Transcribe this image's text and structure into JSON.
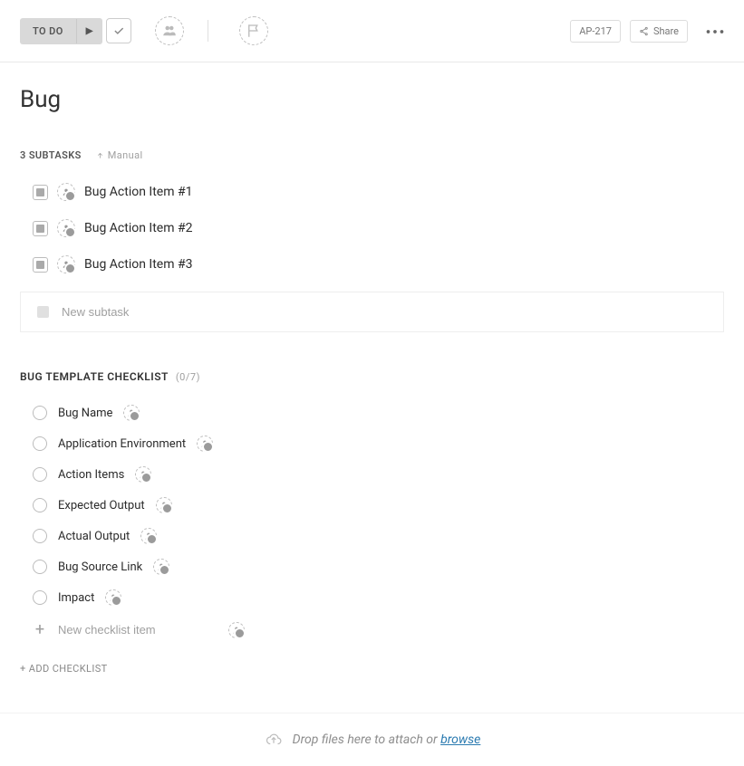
{
  "toolbar": {
    "status_label": "TO DO",
    "ticket_id": "AP-217",
    "share_label": "Share"
  },
  "title": "Bug",
  "subtasks": {
    "header": "3 SUBTASKS",
    "sort_label": "Manual",
    "items": [
      {
        "title": "Bug Action Item #1"
      },
      {
        "title": "Bug Action Item #2"
      },
      {
        "title": "Bug Action Item #3"
      }
    ],
    "new_placeholder": "New subtask"
  },
  "checklist": {
    "title": "BUG TEMPLATE CHECKLIST",
    "count": "(0/7)",
    "items": [
      {
        "label": "Bug Name"
      },
      {
        "label": "Application Environment"
      },
      {
        "label": "Action Items"
      },
      {
        "label": "Expected Output"
      },
      {
        "label": "Actual Output"
      },
      {
        "label": "Bug Source Link"
      },
      {
        "label": "Impact"
      }
    ],
    "new_placeholder": "New checklist item"
  },
  "add_checklist_label": "+ ADD CHECKLIST",
  "dropzone": {
    "text": "Drop files here to attach or ",
    "browse": "browse"
  }
}
